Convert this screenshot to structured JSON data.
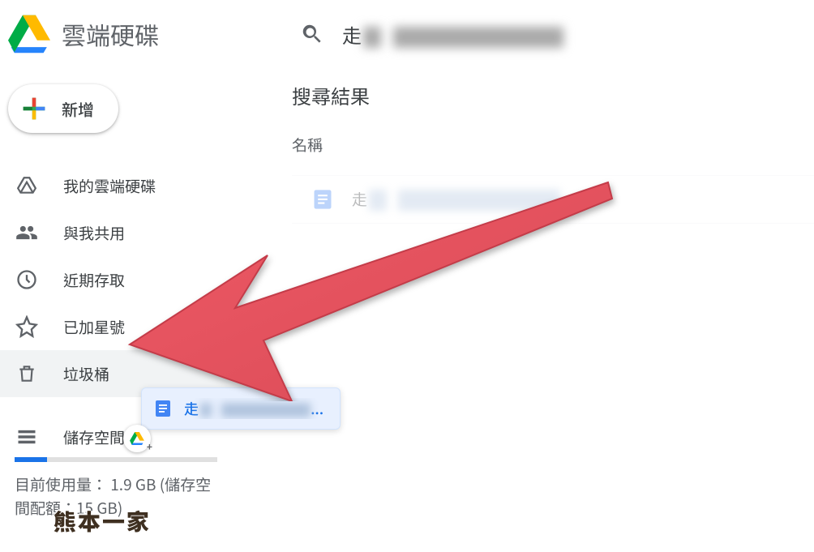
{
  "app": {
    "title": "雲端硬碟"
  },
  "search": {
    "prefix": "走"
  },
  "newButton": {
    "label": "新增"
  },
  "sidebar": {
    "items": [
      {
        "label": "我的雲端硬碟",
        "icon": "drive"
      },
      {
        "label": "與我共用",
        "icon": "people"
      },
      {
        "label": "近期存取",
        "icon": "clock"
      },
      {
        "label": "已加星號",
        "icon": "star"
      },
      {
        "label": "垃圾桶",
        "icon": "trash"
      }
    ]
  },
  "storage": {
    "label": "儲存空間",
    "usageLine1": "目前使用量： 1.9 GB (儲存空",
    "usageLine2": "間配額：15 GB)"
  },
  "results": {
    "heading": "搜尋結果",
    "columnName": "名稱",
    "item": {
      "prefix": "走"
    }
  },
  "dragChip": {
    "prefix": "走",
    "suffix": "..."
  }
}
